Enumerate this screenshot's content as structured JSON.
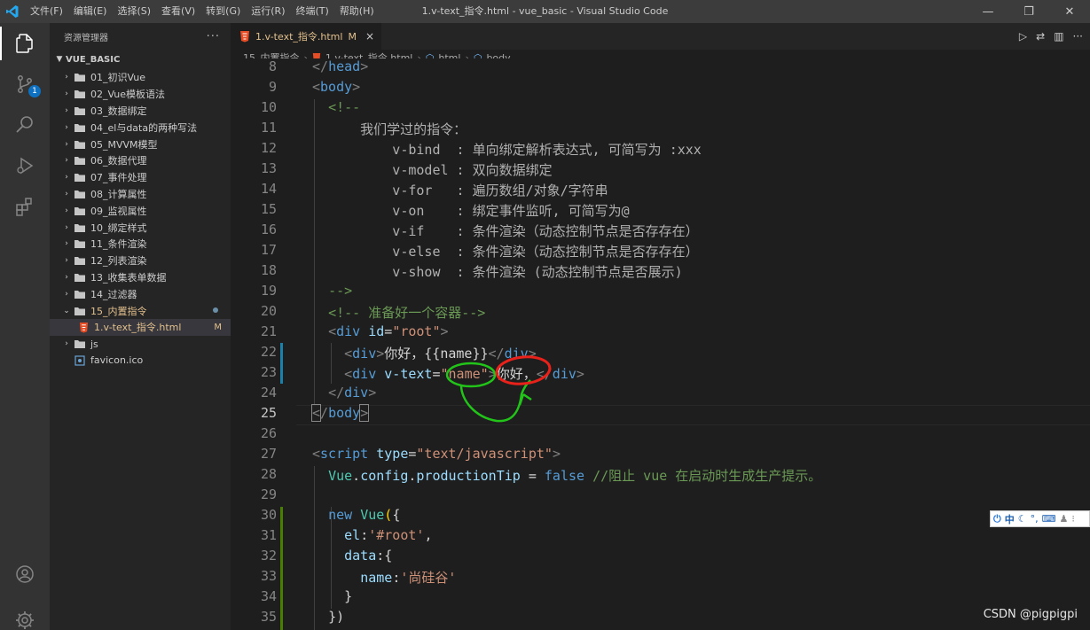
{
  "window": {
    "title": "1.v-text_指令.html - vue_basic - Visual Studio Code",
    "menu": [
      "文件(F)",
      "编辑(E)",
      "选择(S)",
      "查看(V)",
      "转到(G)",
      "运行(R)",
      "终端(T)",
      "帮助(H)"
    ]
  },
  "activity": {
    "scm_badge": "1"
  },
  "explorer": {
    "header": "资源管理器",
    "more": "···",
    "section": "VUE_BASIC",
    "items": [
      {
        "label": "01_初识Vue",
        "type": "folder"
      },
      {
        "label": "02_Vue模板语法",
        "type": "folder"
      },
      {
        "label": "03_数据绑定",
        "type": "folder"
      },
      {
        "label": "04_el与data的两种写法",
        "type": "folder"
      },
      {
        "label": "05_MVVM模型",
        "type": "folder"
      },
      {
        "label": "06_数据代理",
        "type": "folder"
      },
      {
        "label": "07_事件处理",
        "type": "folder"
      },
      {
        "label": "08_计算属性",
        "type": "folder"
      },
      {
        "label": "09_监视属性",
        "type": "folder"
      },
      {
        "label": "10_绑定样式",
        "type": "folder"
      },
      {
        "label": "11_条件渲染",
        "type": "folder"
      },
      {
        "label": "12_列表渲染",
        "type": "folder"
      },
      {
        "label": "13_收集表单数据",
        "type": "folder"
      },
      {
        "label": "14_过滤器",
        "type": "folder"
      },
      {
        "label": "15_内置指令",
        "type": "folder-open"
      },
      {
        "label": "1.v-text_指令.html",
        "type": "html",
        "status": "M"
      },
      {
        "label": "js",
        "type": "folder"
      },
      {
        "label": "favicon.ico",
        "type": "ico"
      }
    ]
  },
  "tab": {
    "label": "1.v-text_指令.html",
    "status": "M",
    "close": "×"
  },
  "breadcrumb": [
    "15_内置指令",
    "1.v-text_指令.html",
    "html",
    "body"
  ],
  "editor": {
    "line_numbers": [
      "8",
      "9",
      "10",
      "11",
      "12",
      "13",
      "14",
      "15",
      "16",
      "17",
      "18",
      "19",
      "20",
      "21",
      "22",
      "23",
      "24",
      "25",
      "26",
      "27",
      "28",
      "29",
      "30",
      "31",
      "32",
      "33",
      "34",
      "35"
    ],
    "current_line": "25"
  },
  "ime": {
    "text": "中"
  },
  "watermark": "CSDN @pigpigpi",
  "colors": {
    "accent": "#0e70c0",
    "modified": "#e2c08d",
    "annotation_red": "#e8211a",
    "annotation_green": "#22c41a"
  }
}
